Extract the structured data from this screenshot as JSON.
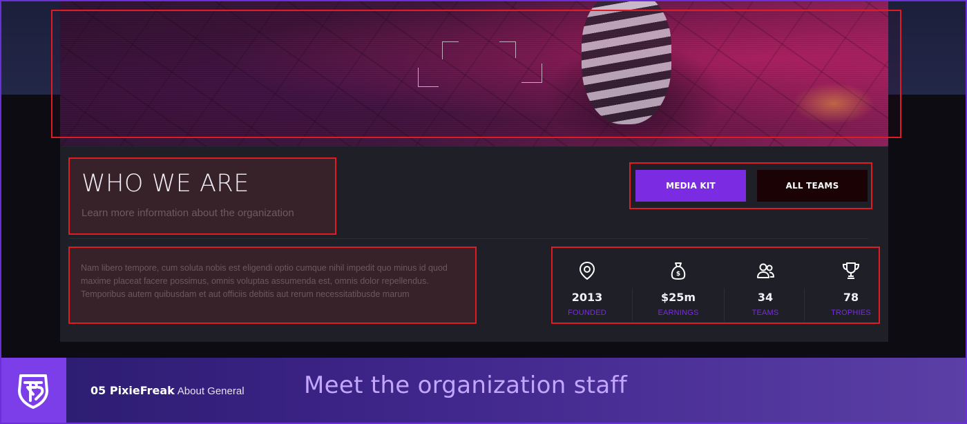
{
  "about": {
    "heading": "WHO WE ARE",
    "subheading": "Learn more information about the organization",
    "description": "Nam libero tempore, cum soluta nobis est eligendi optio cumque nihil impedit quo minus id quod maxime placeat facere possimus, omnis voluptas assumenda est, omnis dolor repellendus. Temporibus autem quibusdam et aut officiis debitis aut rerum necessitatibusde marum"
  },
  "buttons": {
    "media_kit": "MEDIA KIT",
    "all_teams": "ALL TEAMS"
  },
  "stats": [
    {
      "icon": "map-pin-icon",
      "value": "2013",
      "label": "FOUNDED"
    },
    {
      "icon": "money-bag-icon",
      "value": "$25m",
      "label": "EARNINGS"
    },
    {
      "icon": "users-icon",
      "value": "34",
      "label": "TEAMS"
    },
    {
      "icon": "trophy-icon",
      "value": "78",
      "label": "TROPHIES"
    }
  ],
  "footer": {
    "lesson_number_name": "05 PixieFreak",
    "lesson_tag": "About General",
    "title": "Meet the organization staff"
  },
  "colors": {
    "accent": "#7b2be2",
    "highlight": "#e01b24",
    "panel": "#1f1f28"
  }
}
